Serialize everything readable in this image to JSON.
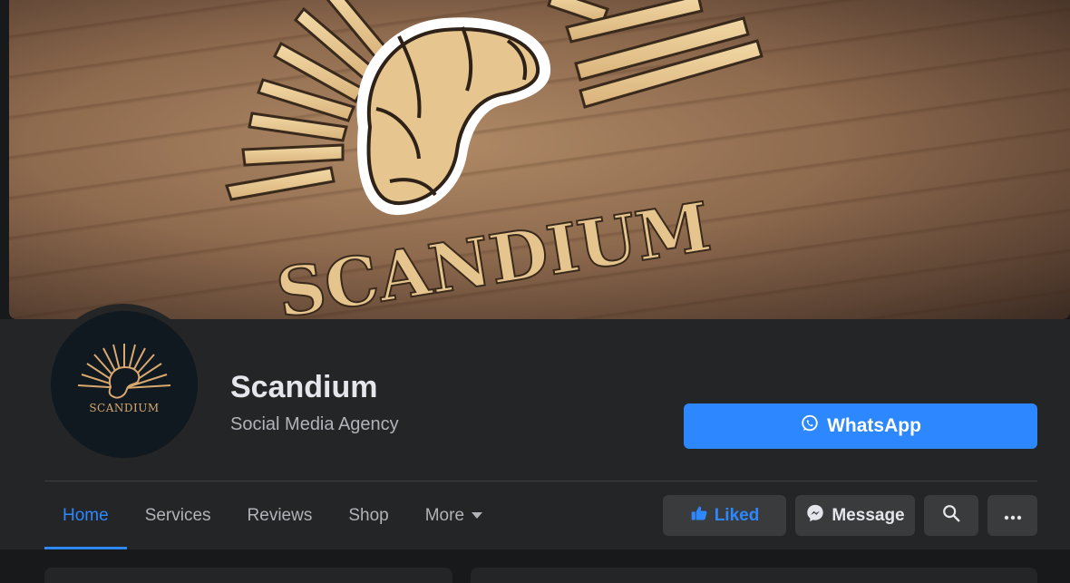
{
  "cover": {
    "logo_text": "SCANDIUM"
  },
  "profile": {
    "avatar_text": "SCANDIUM",
    "name": "Scandium",
    "category": "Social Media Agency"
  },
  "cta": {
    "label": "WhatsApp",
    "icon": "whatsapp-icon"
  },
  "tabs": [
    {
      "label": "Home",
      "active": true
    },
    {
      "label": "Services"
    },
    {
      "label": "Reviews"
    },
    {
      "label": "Shop"
    },
    {
      "label": "More"
    }
  ],
  "actions": {
    "liked": "Liked",
    "message": "Message"
  },
  "colors": {
    "accent": "#2d88ff",
    "panel": "#242526",
    "gold": "#e3c48c"
  }
}
